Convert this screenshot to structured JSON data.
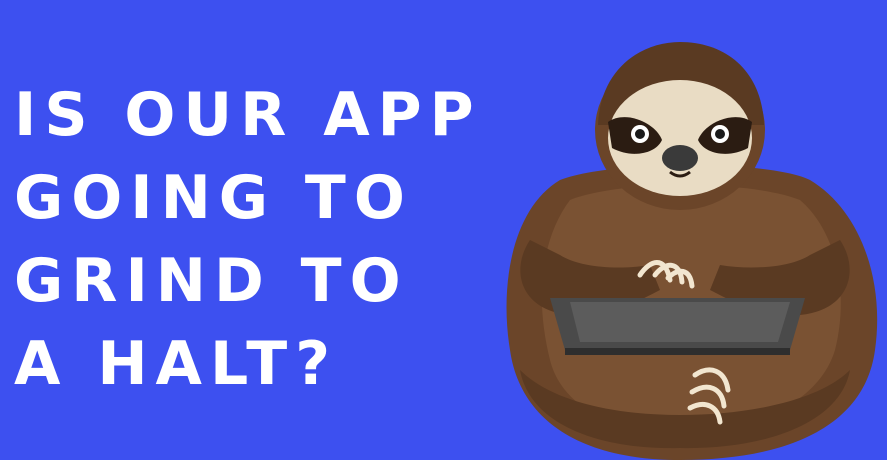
{
  "headline": {
    "lines": [
      "IS OUR APP",
      "GOING TO",
      "GRIND TO",
      "A HALT?"
    ]
  },
  "illustration": {
    "subject": "sloth typing on laptop",
    "icon": "sloth-icon"
  },
  "colors": {
    "background": "#3d50f0",
    "text": "#ffffff",
    "fur_dark": "#5a3a22",
    "fur_mid": "#7a5233",
    "face": "#e9dcc4",
    "laptop": "#4a4a4a",
    "claws": "#f2e6d0"
  }
}
